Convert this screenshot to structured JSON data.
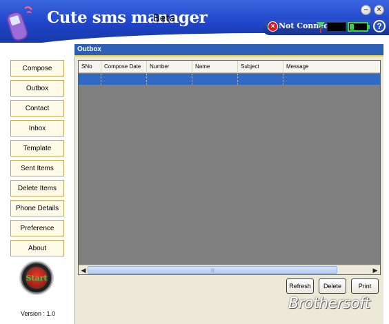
{
  "app": {
    "title": "Cute sms manager",
    "beta": "Beta"
  },
  "status": {
    "connection": "Not Connect",
    "help": "?"
  },
  "window_controls": {
    "minimize": "–",
    "close": "×"
  },
  "sidebar": {
    "items": [
      {
        "label": "Compose"
      },
      {
        "label": "Outbox"
      },
      {
        "label": "Contact"
      },
      {
        "label": "Inbox"
      },
      {
        "label": "Template"
      },
      {
        "label": "Sent Items"
      },
      {
        "label": "Delete Items"
      },
      {
        "label": "Phone Details"
      },
      {
        "label": "Preference"
      },
      {
        "label": "About"
      }
    ],
    "start_label": "Start",
    "version": "Version : 1.0"
  },
  "panel": {
    "title": "Outbox",
    "columns": [
      "SNo",
      "Compose Date",
      "Number",
      "Name",
      "Subject",
      "Message"
    ]
  },
  "actions": {
    "refresh": "Refresh",
    "delete": "Delete",
    "print": "Print"
  },
  "watermark": "Brothersoft",
  "colors": {
    "header_blue": "#1f44c8",
    "selection": "#316ac5",
    "panel_header": "#2c5fb5"
  }
}
